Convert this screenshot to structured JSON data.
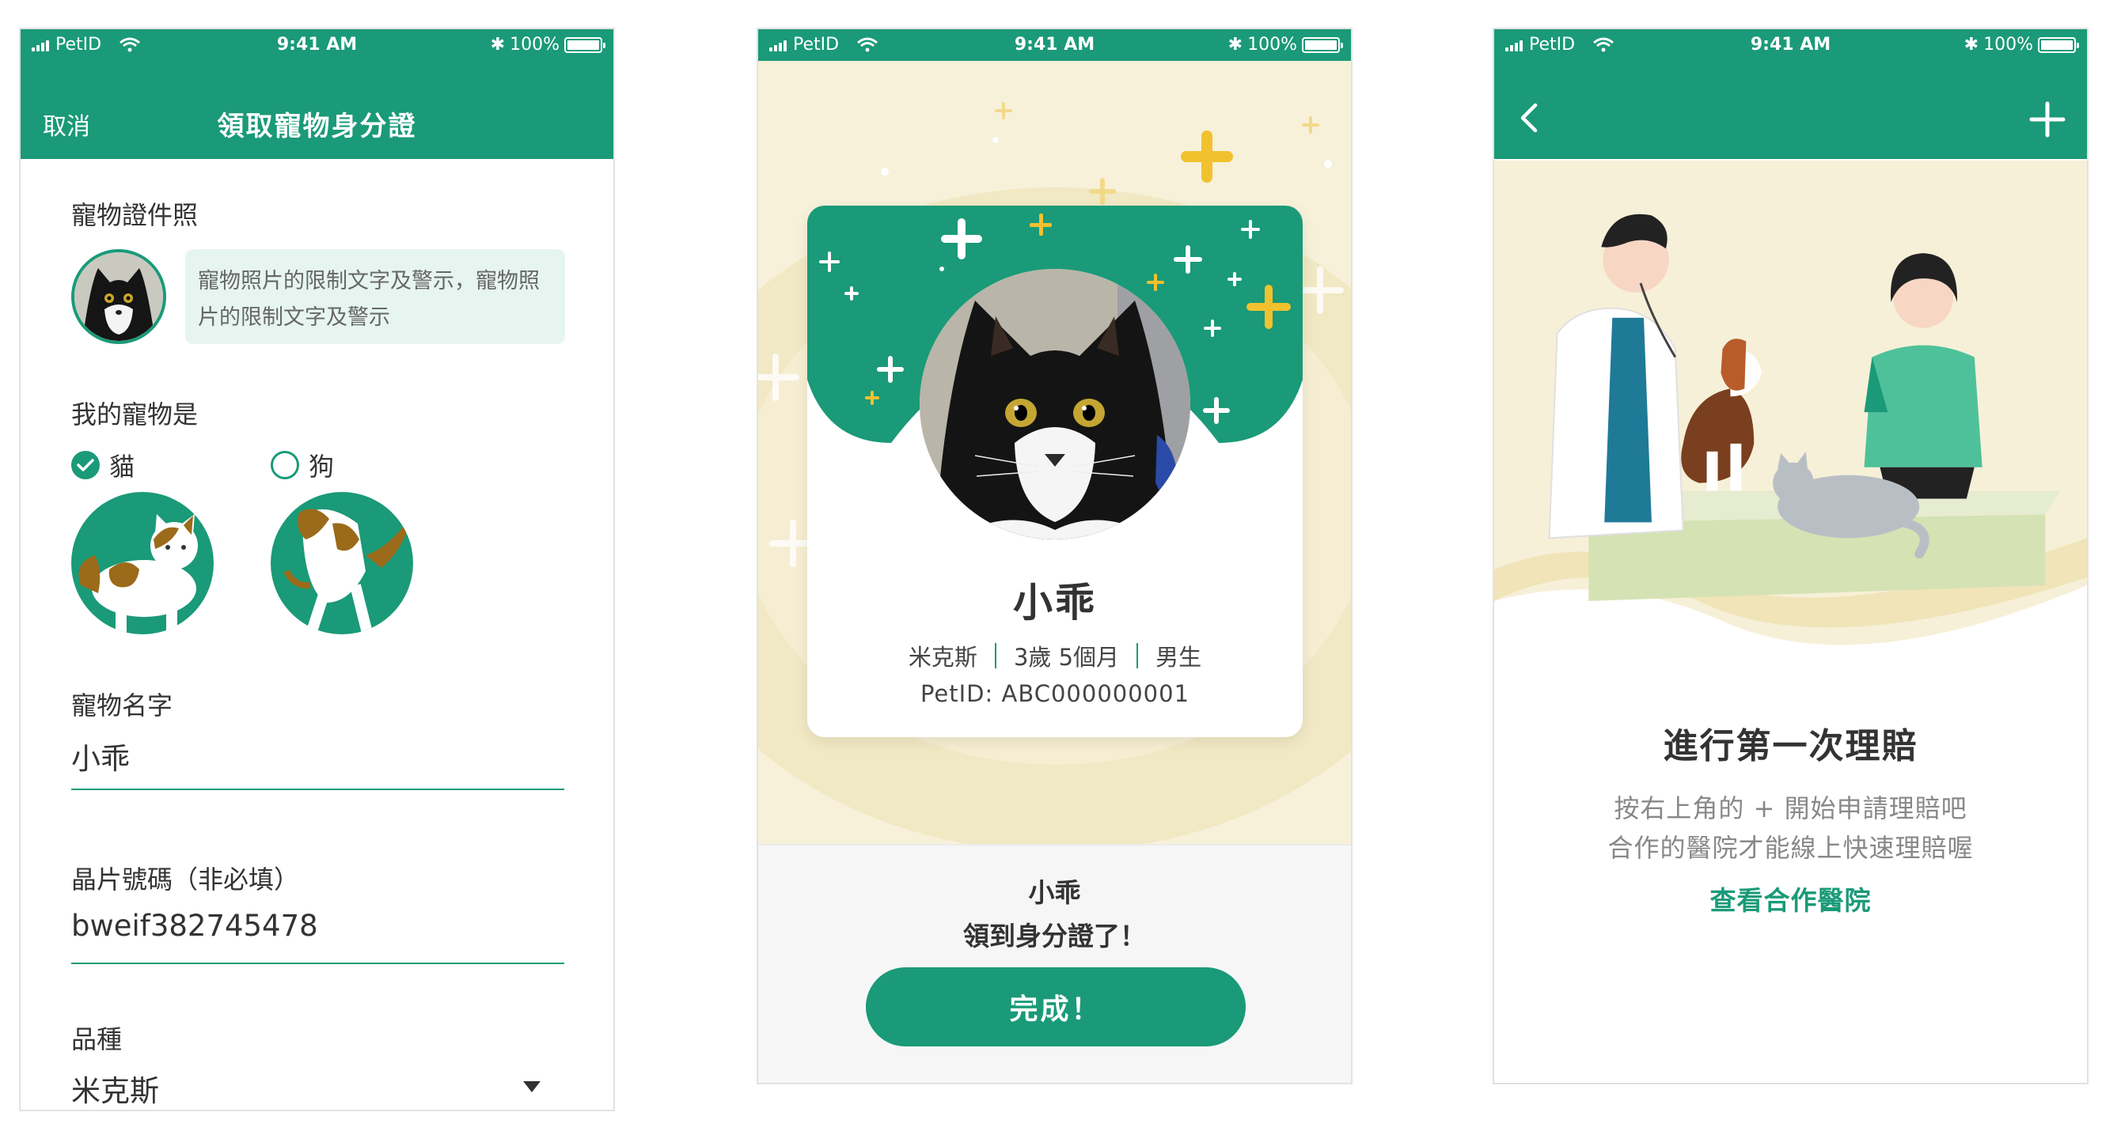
{
  "status_bar": {
    "carrier": "PetID",
    "time": "9:41 AM",
    "battery": "100%"
  },
  "screen1": {
    "cancel": "取消",
    "title": "領取寵物身分證",
    "photo_label": "寵物證件照",
    "photo_notice": "寵物照片的限制文字及警示，寵物照片的限制文字及警示",
    "pet_type_label": "我的寵物是",
    "options": [
      {
        "label": "貓",
        "checked": true
      },
      {
        "label": "狗",
        "checked": false
      }
    ],
    "name_label": "寵物名字",
    "name_value": "小乖",
    "chip_label": "晶片號碼（非必填）",
    "chip_value": "bweif382745478",
    "breed_label": "品種",
    "breed_value": "米克斯"
  },
  "screen2": {
    "card_name": "小乖",
    "breed": "米克斯",
    "age": "3歲 5個月",
    "gender": "男生",
    "petid": "PetID: ABC000000001",
    "bottom_name": "小乖",
    "bottom_msg": "領到身分證了！",
    "done_button": "完成！"
  },
  "screen3": {
    "title": "進行第一次理賠",
    "desc_line1": "按右上角的 + 開始申請理賠吧",
    "desc_line2": "合作的醫院才能線上快速理賠喔",
    "link": "查看合作醫院"
  },
  "colors": {
    "brand_green": "#1a9a78",
    "accent_yellow": "#f2c12e",
    "cream": "#f7f1da"
  }
}
